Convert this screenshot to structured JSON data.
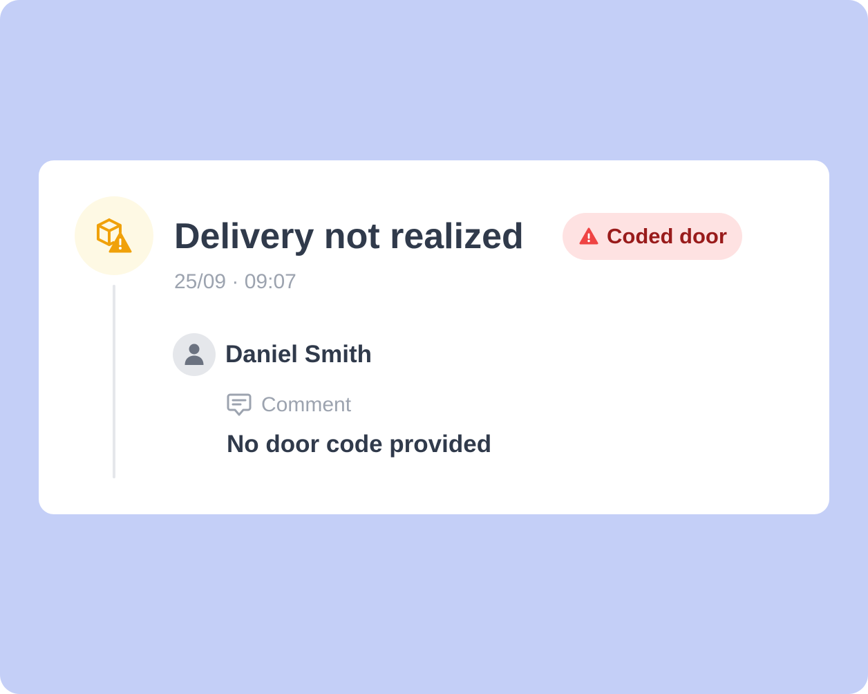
{
  "event": {
    "title": "Delivery not realized",
    "timestamp": "25/09 · 09:07",
    "icon": "package-warning-icon",
    "badge": {
      "label": "Coded door",
      "icon": "warning-triangle-icon"
    }
  },
  "author": {
    "name": "Daniel Smith",
    "avatar_icon": "user-icon"
  },
  "comment": {
    "label": "Comment",
    "icon": "comment-icon",
    "text": "No door code provided"
  },
  "colors": {
    "background": "#c4cff7",
    "card": "#ffffff",
    "icon_accent": "#f0a10a",
    "badge_background": "#fee2e2",
    "badge_text": "#991b1b",
    "badge_icon": "#ef4444",
    "primary_text": "#303a4b",
    "muted_text": "#9ca3af"
  }
}
